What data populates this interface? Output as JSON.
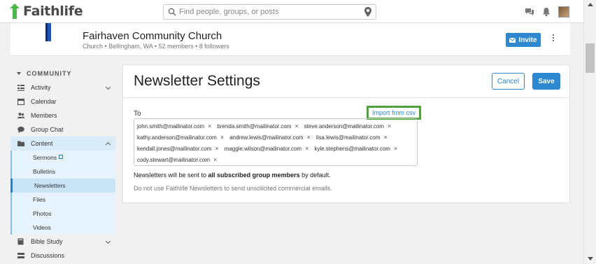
{
  "app": {
    "logo_text": "Faithlife",
    "brand_color": "#4db848",
    "search_placeholder": "Find people, groups, or posts"
  },
  "top_icons": [
    "chat-icon",
    "bell-icon",
    "user-avatar"
  ],
  "group": {
    "name": "Fairhaven Community Church",
    "type": "Church",
    "location": "Bellingham, WA",
    "members": "52 members",
    "followers": "8 followers",
    "invite_label": "Invite"
  },
  "sidebar": {
    "section_title": "COMMUNITY",
    "items": [
      {
        "label": "Activity",
        "icon": "activity-icon",
        "expandable": true
      },
      {
        "label": "Calendar",
        "icon": "calendar-icon"
      },
      {
        "label": "Members",
        "icon": "members-icon"
      },
      {
        "label": "Group Chat",
        "icon": "chat-icon"
      },
      {
        "label": "Content",
        "icon": "folder-icon",
        "expanded": true
      }
    ],
    "content_sub": [
      {
        "label": "Sermons",
        "external": true
      },
      {
        "label": "Bulletins"
      },
      {
        "label": "Newsletters",
        "active": true
      },
      {
        "label": "Files"
      },
      {
        "label": "Photos"
      },
      {
        "label": "Videos"
      }
    ],
    "after": [
      {
        "label": "Bible Study",
        "icon": "book-icon",
        "expandable": true
      },
      {
        "label": "Discussions",
        "icon": "discussion-icon"
      }
    ]
  },
  "main": {
    "title": "Newsletter Settings",
    "cancel_label": "Cancel",
    "save_label": "Save",
    "to_label": "To",
    "import_label": "Import from csv",
    "recipients": [
      "john.smith@mailinator.com",
      "brenda.smith@mailinator.com",
      "steve.anderson@mailinator.com",
      "kathy.anderson@mailinator.com",
      "andrew.lewis@mailinator.com",
      "lisa.lewis@mailinator.com",
      "kendall.jones@mailinator.com",
      "maggie.wilson@mailinator.com",
      "kyle.stephens@mailinator.com",
      "cody.stewart@mailinator.com"
    ],
    "note_prefix": "Newsletters will be sent to ",
    "note_bold": "all subscribed group members",
    "note_suffix": " by default.",
    "note_secondary": "Do not use Faithlife Newsletters to send unsolicited commercial emails.",
    "accent_color": "#2d88d0",
    "highlight_color": "#4ea53a"
  }
}
